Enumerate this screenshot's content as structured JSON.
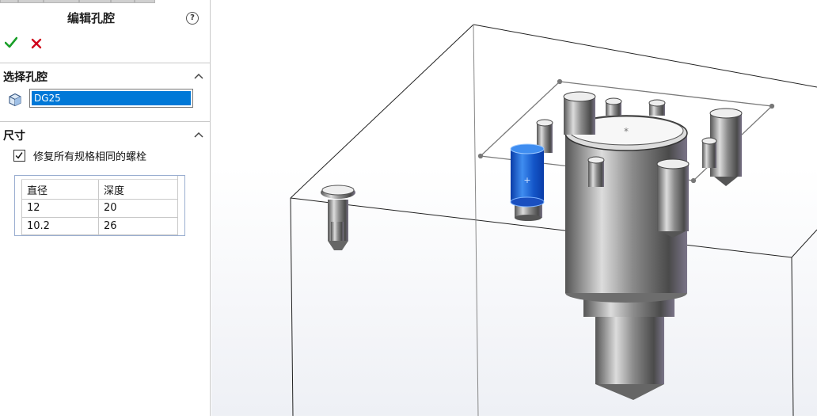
{
  "panel": {
    "title": "编辑孔腔",
    "help_icon": "?",
    "ok_icon": "check-icon",
    "cancel_icon": "x-icon",
    "colors": {
      "ok": "#1a9f29",
      "cancel": "#d0021b",
      "selection": "#0078d7"
    }
  },
  "select_section": {
    "title": "选择孔腔",
    "field_value": "DG25"
  },
  "size_section": {
    "title": "尺寸",
    "checkbox_label": "修复所有规格相同的螺栓",
    "checkbox_checked": true,
    "table": {
      "headers": [
        "直径",
        "深度"
      ],
      "rows": [
        [
          "12",
          "20"
        ],
        [
          "10.2",
          "26"
        ]
      ]
    }
  },
  "viewport": {
    "model": "3d-block-with-cylindrical-holes",
    "selected_color": "#1565d8"
  }
}
